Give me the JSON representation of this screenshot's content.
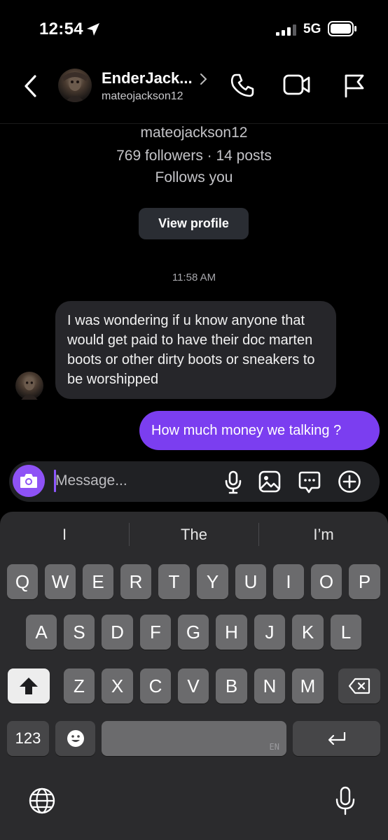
{
  "status_bar": {
    "time": "12:54",
    "network": "5G"
  },
  "header": {
    "name": "EnderJack...",
    "username": "mateojackson12"
  },
  "profile": {
    "username": "mateojackson12",
    "stats": "769 followers · 14 posts",
    "follows": "Follows you",
    "view_profile_label": "View profile"
  },
  "conversation": {
    "timestamp": "11:58 AM",
    "received_message": "I was wondering if u know anyone that would get paid to have their doc marten boots or other dirty boots or sneakers to be worshipped",
    "sent_message": "How much money we talking ?"
  },
  "composer": {
    "placeholder": "Message..."
  },
  "keyboard": {
    "suggestions": [
      "I",
      "The",
      "I’m"
    ],
    "row1": [
      "Q",
      "W",
      "E",
      "R",
      "T",
      "Y",
      "U",
      "I",
      "O",
      "P"
    ],
    "row2": [
      "A",
      "S",
      "D",
      "F",
      "G",
      "H",
      "J",
      "K",
      "L"
    ],
    "row3": [
      "Z",
      "X",
      "C",
      "V",
      "B",
      "N",
      "M"
    ],
    "numbers_label": "123",
    "space_language": "EN"
  },
  "icons": [
    "location-arrow-icon",
    "signal-icon",
    "battery-icon",
    "back-chevron-icon",
    "phone-icon",
    "video-camera-icon",
    "flag-icon",
    "camera-icon",
    "microphone-icon",
    "image-icon",
    "sticker-icon",
    "plus-circle-icon",
    "shift-icon",
    "backspace-icon",
    "emoji-icon",
    "return-icon",
    "globe-icon",
    "dictation-icon"
  ],
  "colors": {
    "accent": "#7b3ef0",
    "camera_button": "#8e52f6",
    "received_bubble": "#26262a",
    "background": "#000000"
  }
}
